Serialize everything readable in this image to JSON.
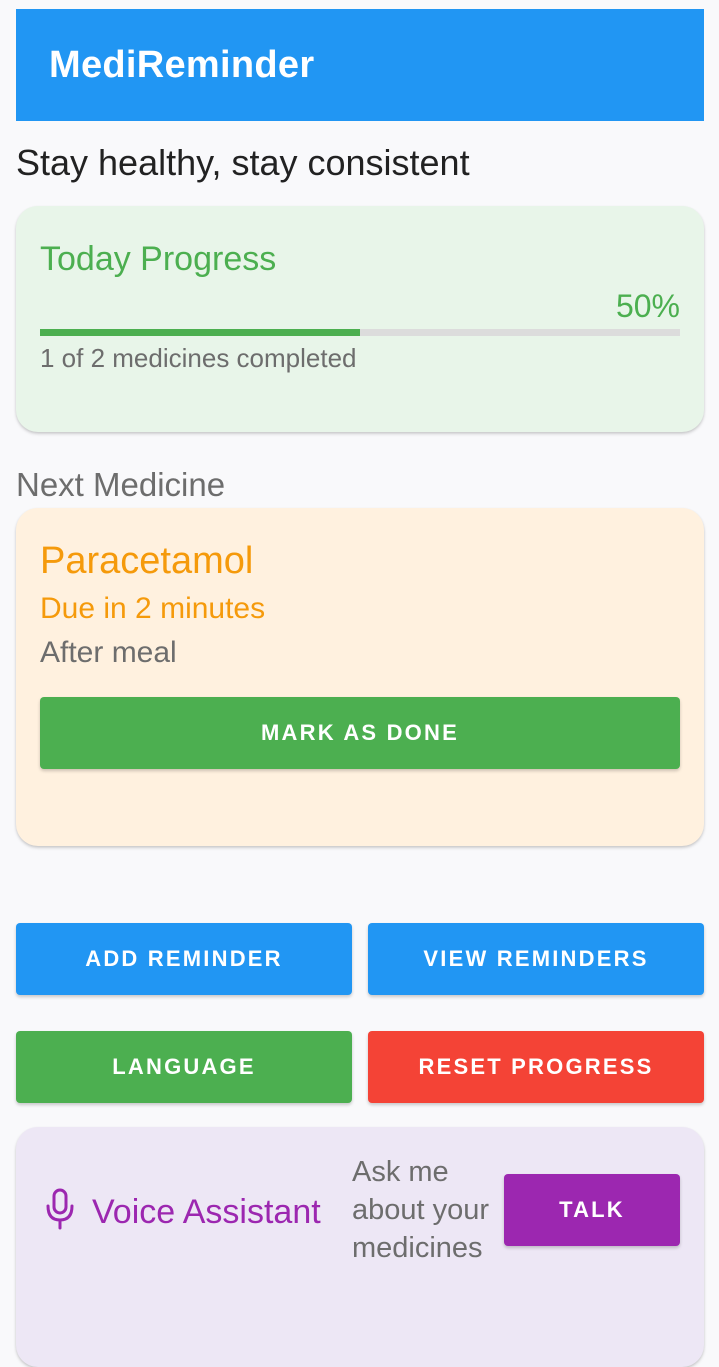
{
  "app": {
    "title": "MediReminder"
  },
  "subtitle": "Stay healthy, stay consistent",
  "progress": {
    "title": "Today Progress",
    "percent_label": "50%",
    "fraction": 0.5,
    "count_text": "1 of 2 medicines completed"
  },
  "next": {
    "section_label": "Next Medicine",
    "name": "Paracetamol",
    "due": "Due in 2 minutes",
    "note": "After meal",
    "done_label": "MARK AS DONE"
  },
  "actions": {
    "add_label": "ADD REMINDER",
    "view_label": "VIEW REMINDERS",
    "language_label": "LANGUAGE",
    "reset_label": "RESET PROGRESS"
  },
  "voice": {
    "icon": "microphone-icon",
    "title": "Voice Assistant",
    "hint": "Ask me about your medicines",
    "talk_label": "TALK"
  },
  "colors": {
    "primary": "#2196f3",
    "success": "#4caf50",
    "warning": "#f59a0b",
    "danger": "#f44336",
    "voice": "#9c27b0"
  }
}
